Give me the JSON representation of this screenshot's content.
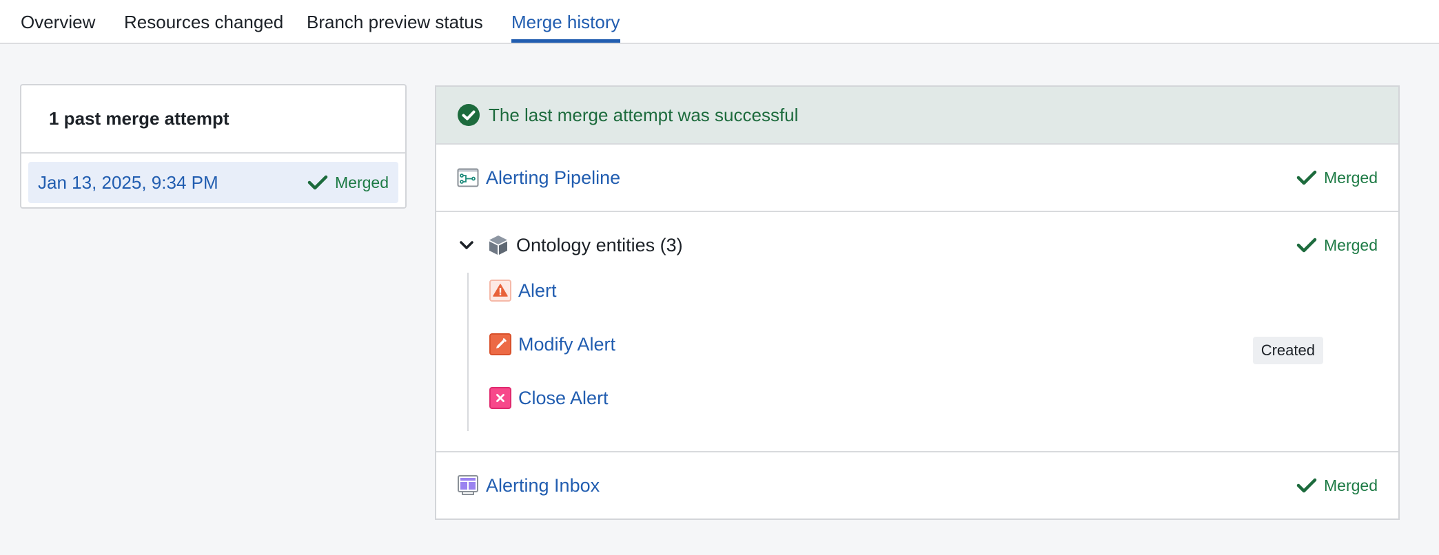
{
  "tabs": [
    {
      "label": "Overview",
      "active": false
    },
    {
      "label": "Resources changed",
      "active": false
    },
    {
      "label": "Branch preview status",
      "active": false
    },
    {
      "label": "Merge history",
      "active": true
    }
  ],
  "history": {
    "title": "1 past merge attempt",
    "attempts": [
      {
        "date": "Jan 13, 2025, 9:34 PM",
        "status": "Merged",
        "selected": true
      }
    ]
  },
  "detail": {
    "banner": {
      "icon": "check-circle-icon",
      "text": "The last merge attempt was successful"
    },
    "resources": [
      {
        "name": "Alerting Pipeline",
        "icon": "pipeline-icon",
        "status": "Merged"
      },
      {
        "name": "Ontology entities (3)",
        "icon": "cube-icon",
        "status": "Merged",
        "expanded": true,
        "children": [
          {
            "name": "Alert",
            "icon": "warning-icon",
            "badge": ""
          },
          {
            "name": "Modify Alert",
            "icon": "pencil-icon",
            "badge": "Created"
          },
          {
            "name": "Close Alert",
            "icon": "close-icon",
            "badge": ""
          }
        ]
      },
      {
        "name": "Alerting Inbox",
        "icon": "workshop-app-icon",
        "status": "Merged"
      }
    ]
  },
  "colors": {
    "accent": "#215db0",
    "success": "#1c7a44",
    "banner_bg": "#e1e9e7",
    "selected_row_bg": "#e8eef9"
  }
}
